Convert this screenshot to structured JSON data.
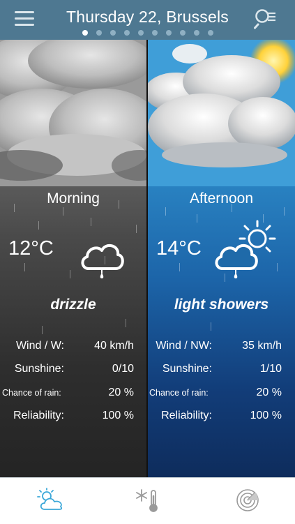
{
  "header": {
    "title": "Thursday 22, Brussels",
    "page_count": 10,
    "active_page": 0,
    "menu_icon": "hamburger-menu-icon",
    "search_icon": "search-list-icon"
  },
  "panels": [
    {
      "period": "Morning",
      "temperature": "12°C",
      "condition": "drizzle",
      "icon": "drizzle-cloud-icon",
      "rows": [
        {
          "label": "Wind / W:",
          "value": "40 km/h"
        },
        {
          "label": "Sunshine:",
          "value": "0/10"
        },
        {
          "label": "Chance of rain:",
          "value": "20 %"
        },
        {
          "label": "Reliability:",
          "value": "100 %"
        }
      ]
    },
    {
      "period": "Afternoon",
      "temperature": "14°C",
      "condition": "light showers",
      "icon": "sun-cloud-rain-icon",
      "rows": [
        {
          "label": "Wind / NW:",
          "value": "35 km/h"
        },
        {
          "label": "Sunshine:",
          "value": "1/10"
        },
        {
          "label": "Chance of rain:",
          "value": "20 %"
        },
        {
          "label": "Reliability:",
          "value": "100 %"
        }
      ]
    }
  ],
  "tabbar": {
    "tabs": [
      {
        "icon": "weather-forecast-icon",
        "active": true
      },
      {
        "icon": "snow-thermometer-icon",
        "active": false
      },
      {
        "icon": "radar-icon",
        "active": false
      }
    ],
    "active_color": "#3aa7d8",
    "inactive_color": "#9a9a9a"
  },
  "colors": {
    "header_bg": "#4e7891",
    "morning_bg": "#4a4a4a",
    "afternoon_bg": "#1c64a8"
  }
}
